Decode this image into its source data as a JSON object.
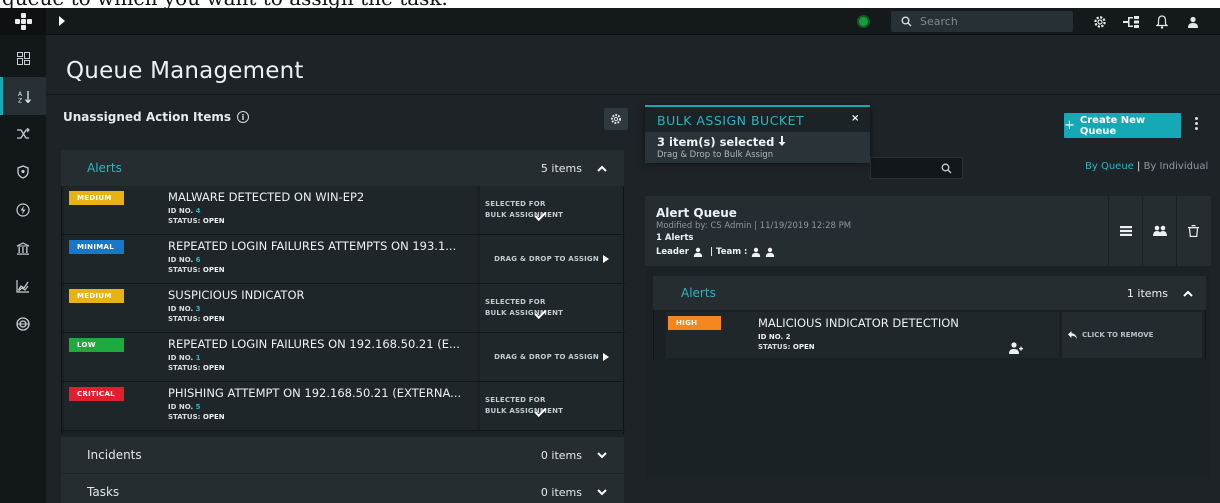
{
  "caption": "queue to which you want to assign the task.",
  "topbar": {
    "search_placeholder": "Search",
    "status_color": "#1a9b3c"
  },
  "nav": {
    "items": [
      "dashboard-icon",
      "queue-management-icon",
      "shuffle-icon",
      "shield-icon",
      "bolt-icon",
      "bank-icon",
      "chart-icon",
      "globe-icon"
    ],
    "active": "queue-management-icon"
  },
  "page": {
    "title": "Queue Management"
  },
  "unassigned": {
    "title": "Unassigned Action Items",
    "sections": {
      "alerts": {
        "label": "Alerts",
        "count": "5 items"
      },
      "incidents": {
        "label": "Incidents",
        "count": "0 items"
      },
      "tasks": {
        "label": "Tasks",
        "count": "0 items"
      }
    },
    "id_label": "ID NO.",
    "status_label": "STATUS:",
    "alerts": [
      {
        "severity": "MEDIUM",
        "title": "MALWARE DETECTED ON WIN-EP2",
        "id": "4",
        "status": "OPEN",
        "action": "SELECTED FOR BULK ASSIGNMENT"
      },
      {
        "severity": "MINIMAL",
        "title": "REPEATED LOGIN FAILURES ATTEMPTS ON 193.1...",
        "id": "6",
        "status": "OPEN",
        "action": "DRAG & DROP TO ASSIGN"
      },
      {
        "severity": "MEDIUM",
        "title": "SUSPICIOUS INDICATOR",
        "id": "3",
        "status": "OPEN",
        "action": "SELECTED FOR BULK ASSIGNMENT"
      },
      {
        "severity": "LOW",
        "title": "REPEATED LOGIN FAILURES ON 192.168.50.21 (E...",
        "id": "1",
        "status": "OPEN",
        "action": "DRAG & DROP TO ASSIGN"
      },
      {
        "severity": "CRITICAL",
        "title": "PHISHING ATTEMPT ON 192.168.50.21 (EXTERNA...",
        "id": "5",
        "status": "OPEN",
        "action": "SELECTED FOR BULK ASSIGNMENT"
      }
    ]
  },
  "bucket": {
    "title": "BULK ASSIGN BUCKET",
    "close": "×",
    "selected": "3 item(s) selected",
    "hint": "Drag & Drop to Bulk Assign"
  },
  "queues": {
    "create_label": "Create New Queue",
    "view_by_queue": "By Queue",
    "view_separator": "|",
    "view_by_individual": "By Individual",
    "queue": {
      "name": "Alert Queue",
      "modified": "Modified by: CS Admin | 11/19/2019 12:28 PM",
      "count": "1 Alerts",
      "leader_label": "Leader",
      "team_label": "| Team :",
      "alerts_section": {
        "label": "Alerts",
        "count": "1 items"
      },
      "alerts": [
        {
          "severity": "HIGH",
          "title": "MALICIOUS INDICATOR DETECTION",
          "id": "ID NO. 2",
          "status_label": "STATUS:",
          "status": "OPEN",
          "action": "CLICK TO REMOVE"
        }
      ]
    }
  },
  "colors": {
    "accent": "#17a8b5",
    "medium": "#e9b213",
    "minimal": "#1777c9",
    "low": "#1eab3e",
    "critical": "#e0202f",
    "high": "#f4861f"
  }
}
